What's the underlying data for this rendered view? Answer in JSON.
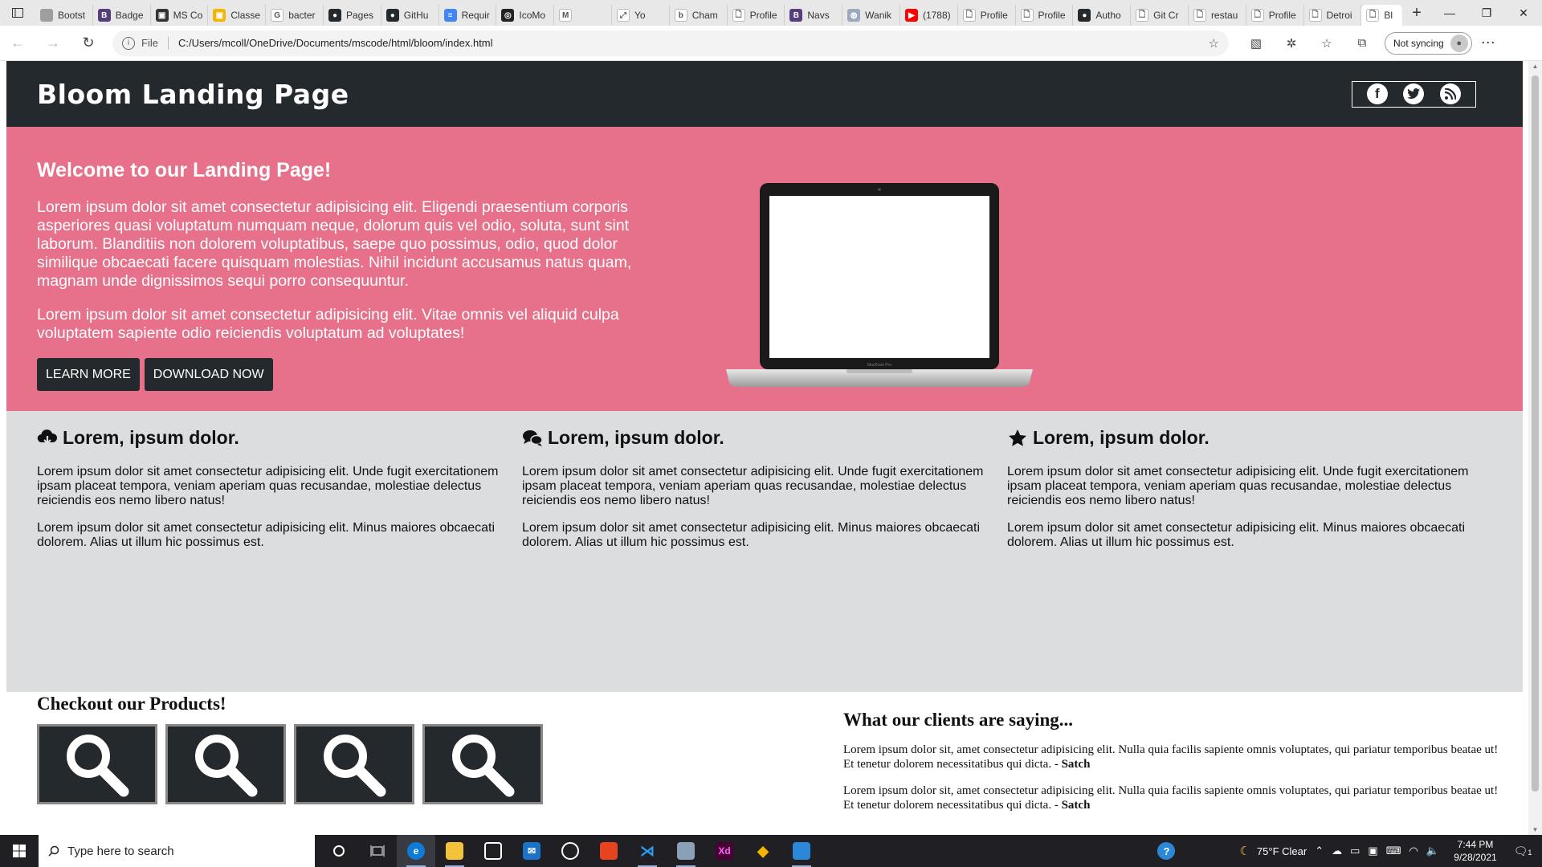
{
  "browser": {
    "tabs": [
      {
        "label": "Bootst",
        "icon": "bootstrap-icon",
        "color": "#9e9e9e",
        "glyph": ""
      },
      {
        "label": "Badge",
        "icon": "bootstrap-icon",
        "color": "#563d7c",
        "glyph": "B"
      },
      {
        "label": "MS Co",
        "icon": "ms-icon",
        "color": "#333333",
        "glyph": "▣"
      },
      {
        "label": "Classe",
        "icon": "classroom-icon",
        "color": "#f4b400",
        "glyph": "▣"
      },
      {
        "label": "bacter",
        "icon": "google-icon",
        "color": "#ffffff",
        "glyph": "G"
      },
      {
        "label": "Pages",
        "icon": "github-icon",
        "color": "#24292d",
        "glyph": "●"
      },
      {
        "label": "GitHu",
        "icon": "github-icon",
        "color": "#24292d",
        "glyph": "●"
      },
      {
        "label": "Requir",
        "icon": "docs-icon",
        "color": "#4285f4",
        "glyph": "≡"
      },
      {
        "label": "IcoMo",
        "icon": "icomoon-icon",
        "color": "#222222",
        "glyph": "◎"
      },
      {
        "label": "",
        "icon": "gmail-icon",
        "color": "#ffffff",
        "glyph": "M"
      },
      {
        "label": "Yo",
        "icon": "link-icon",
        "color": "#ffffff",
        "glyph": "⤢"
      },
      {
        "label": "Cham",
        "icon": "bing-icon",
        "color": "#ffffff",
        "glyph": "b"
      },
      {
        "label": "Profile",
        "icon": "file-icon",
        "color": "#ffffff",
        "glyph": "🗋"
      },
      {
        "label": "Navs",
        "icon": "bootstrap-icon",
        "color": "#563d7c",
        "glyph": "B"
      },
      {
        "label": "Wanik",
        "icon": "globe-icon",
        "color": "#9aa8c0",
        "glyph": "◍"
      },
      {
        "label": "(1788)",
        "icon": "youtube-icon",
        "color": "#ff0000",
        "glyph": "▶"
      },
      {
        "label": "Profile",
        "icon": "file-icon",
        "color": "#ffffff",
        "glyph": "🗋"
      },
      {
        "label": "Profile",
        "icon": "file-icon",
        "color": "#ffffff",
        "glyph": "🗋"
      },
      {
        "label": "Autho",
        "icon": "github-icon",
        "color": "#24292d",
        "glyph": "●"
      },
      {
        "label": "Git Cr",
        "icon": "file-icon",
        "color": "#ffffff",
        "glyph": "🗋"
      },
      {
        "label": "restau",
        "icon": "file-icon",
        "color": "#ffffff",
        "glyph": "🗋"
      },
      {
        "label": "Profile",
        "icon": "file-icon",
        "color": "#ffffff",
        "glyph": "🗋"
      },
      {
        "label": "Detroi",
        "icon": "file-icon",
        "color": "#ffffff",
        "glyph": "🗋"
      },
      {
        "label": "Bl",
        "icon": "file-icon",
        "color": "#ffffff",
        "glyph": "🗋",
        "active": true
      }
    ],
    "address": {
      "scheme": "File",
      "url": "C:/Users/mcoll/OneDrive/Documents/mscode/html/bloom/index.html"
    },
    "sync_label": "Not syncing"
  },
  "site": {
    "brand": "Bloom Landing Page",
    "social_icons": [
      "facebook-icon",
      "twitter-icon",
      "rss-icon"
    ],
    "hero": {
      "title": "Welcome to our Landing Page!",
      "para1": "Lorem ipsum dolor sit amet consectetur adipisicing elit. Eligendi praesentium corporis asperiores quasi voluptatum numquam neque, dolorum quis vel odio, soluta, sunt sint laborum. Blanditiis non dolorem voluptatibus, saepe quo possimus, odio, quod dolor similique obcaecati facere quisquam molestias. Nihil incidunt accusamus natus quam, magnam unde dignissimos sequi porro consequuntur.",
      "para2": "Lorem ipsum dolor sit amet consectetur adipisicing elit. Vitae omnis vel aliquid culpa voluptatem sapiente odio reiciendis voluptatum ad voluptates!",
      "learn_more": "LEARN MORE",
      "download_now": "DOWNLOAD NOW",
      "colors": {
        "hero_bg": "#e7718b",
        "dark": "#24292d",
        "features_bg": "#dcdddf"
      }
    },
    "features": [
      {
        "icon": "cloud-download-icon",
        "heading": "Lorem, ipsum dolor.",
        "p1": "Lorem ipsum dolor sit amet consectetur adipisicing elit. Unde fugit exercitationem ipsam placeat tempora, veniam aperiam quas recusandae, molestiae delectus reiciendis eos nemo libero natus!",
        "p2": "Lorem ipsum dolor sit amet consectetur adipisicing elit. Minus maiores obcaecati dolorem. Alias ut illum hic possimus est."
      },
      {
        "icon": "chat-bubbles-icon",
        "heading": "Lorem, ipsum dolor.",
        "p1": "Lorem ipsum dolor sit amet consectetur adipisicing elit. Unde fugit exercitationem ipsam placeat tempora, veniam aperiam quas recusandae, molestiae delectus reiciendis eos nemo libero natus!",
        "p2": "Lorem ipsum dolor sit amet consectetur adipisicing elit. Minus maiores obcaecati dolorem. Alias ut illum hic possimus est."
      },
      {
        "icon": "star-icon",
        "heading": "Lorem, ipsum dolor.",
        "p1": "Lorem ipsum dolor sit amet consectetur adipisicing elit. Unde fugit exercitationem ipsam placeat tempora, veniam aperiam quas recusandae, molestiae delectus reiciendis eos nemo libero natus!",
        "p2": "Lorem ipsum dolor sit amet consectetur adipisicing elit. Minus maiores obcaecati dolorem. Alias ut illum hic possimus est."
      }
    ],
    "products": {
      "title": "Checkout our Products!",
      "items": [
        "search-icon",
        "search-icon",
        "search-icon",
        "search-icon"
      ]
    },
    "clients": {
      "title": "What our clients are saying...",
      "quotes": [
        {
          "text": "Lorem ipsum dolor sit, amet consectetur adipisicing elit. Nulla quia facilis sapiente omnis voluptates, qui pariatur temporibus beatae ut! Et tenetur dolorem necessitatibus qui dicta. - ",
          "author": "Satch"
        },
        {
          "text": "Lorem ipsum dolor sit, amet consectetur adipisicing elit. Nulla quia facilis sapiente omnis voluptates, qui pariatur temporibus beatae ut! Et tenetur dolorem necessitatibus qui dicta. - ",
          "author": "Satch"
        }
      ]
    }
  },
  "taskbar": {
    "search_placeholder": "Type here to search",
    "weather": "75°F  Clear",
    "time": "7:44 PM",
    "date": "9/28/2021",
    "notification_count": "1"
  }
}
